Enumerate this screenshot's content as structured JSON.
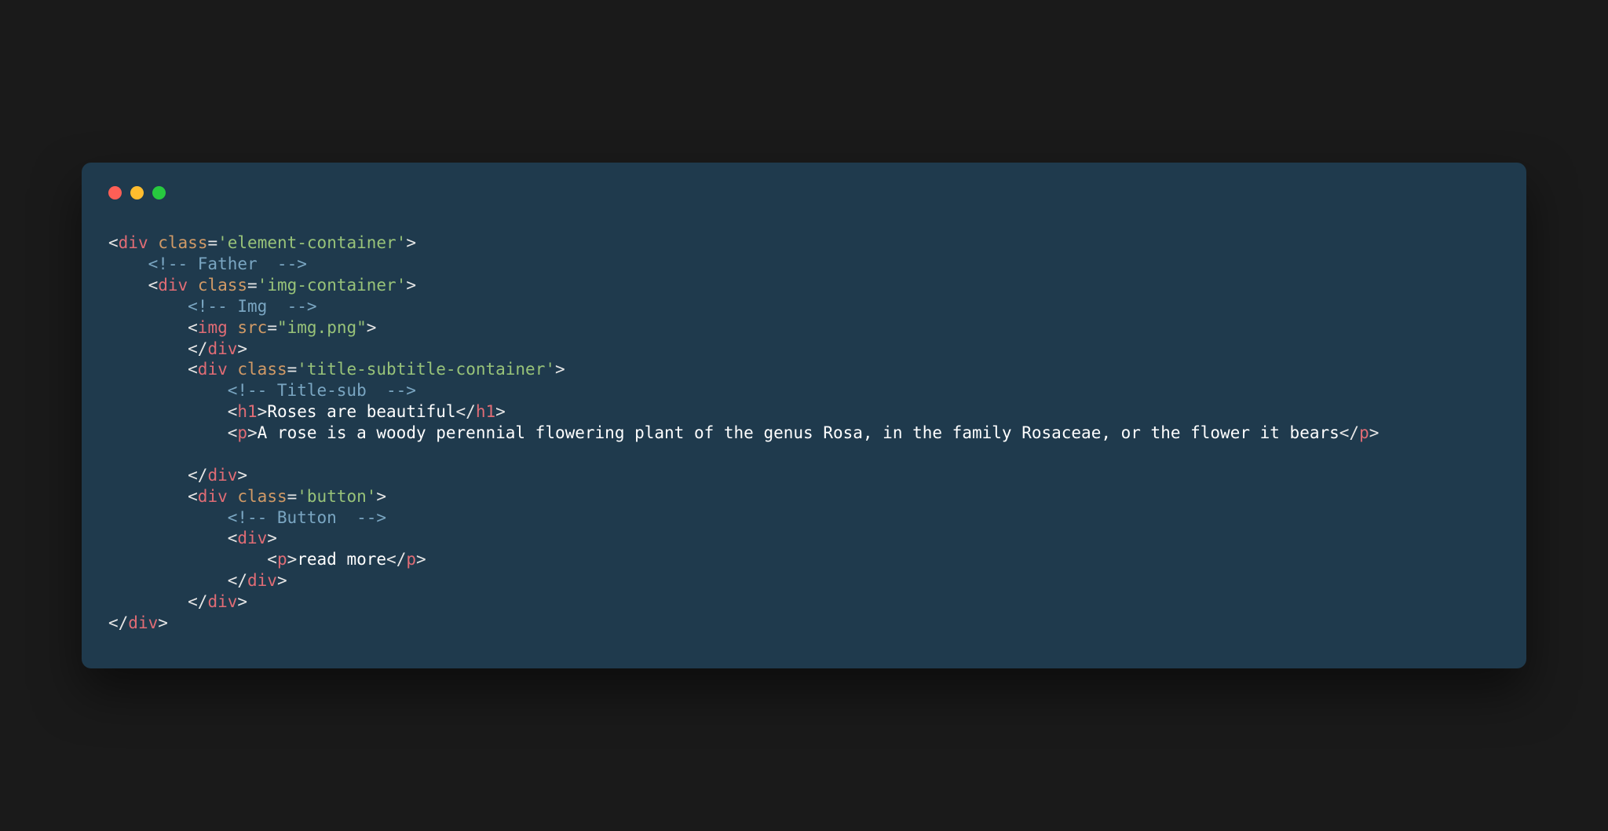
{
  "window": {
    "dots": {
      "red": "#ff5f56",
      "yellow": "#ffbd2e",
      "green": "#27c93f"
    }
  },
  "code": {
    "l1_tag": "div",
    "l1_attr": "class",
    "l1_val": "'element-container'",
    "l2_comment": "<!-- Father  -->",
    "l3_tag": "div",
    "l3_attr": "class",
    "l3_val": "'img-container'",
    "l4_comment": "<!-- Img  -->",
    "l5_tag": "img",
    "l5_attr": "src",
    "l5_val": "\"img.png\"",
    "l6_close": "div",
    "l7_tag": "div",
    "l7_attr": "class",
    "l7_val": "'title-subtitle-container'",
    "l8_comment": "<!-- Title-sub  -->",
    "l9_tag_open": "h1",
    "l9_text": "Roses are beautiful",
    "l9_tag_close": "h1",
    "l10_tag_open": "p",
    "l10_text": "A rose is a woody perennial flowering plant of the genus Rosa, in the family Rosaceae, or the flower it bears",
    "l10_tag_close": "p",
    "l11_close": "div",
    "l12_tag": "div",
    "l12_attr": "class",
    "l12_val": "'button'",
    "l13_comment": "<!-- Button  -->",
    "l14_tag": "div",
    "l15_tag_open": "p",
    "l15_text": "read more",
    "l15_tag_close": "p",
    "l16_close": "div",
    "l17_close": "div",
    "l18_close": "div"
  }
}
